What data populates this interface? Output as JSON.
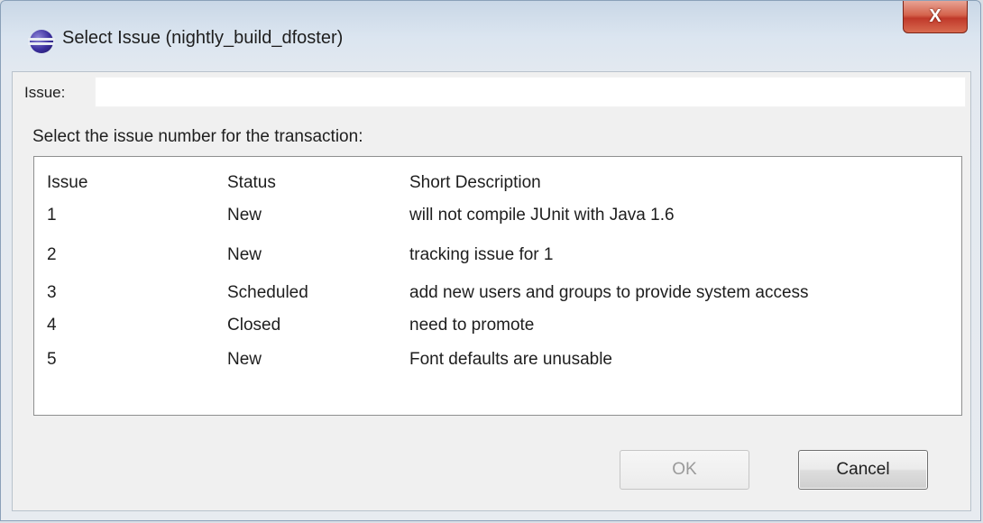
{
  "window": {
    "title": "Select Issue (nightly_build_dfoster)",
    "close_glyph": "X",
    "icon": "eclipse-icon"
  },
  "issue_field": {
    "label": "Issue:",
    "value": ""
  },
  "instruction": "Select the issue number for the transaction:",
  "table": {
    "columns": [
      "Issue",
      "Status",
      "Short Description"
    ],
    "rows": [
      {
        "issue": "1",
        "status": "New",
        "description": "will not compile JUnit with Java 1.6"
      },
      {
        "issue": "2",
        "status": "New",
        "description": "tracking issue for 1"
      },
      {
        "issue": "3",
        "status": "Scheduled",
        "description": "add new users and groups to provide system access"
      },
      {
        "issue": "4",
        "status": "Closed",
        "description": "need to promote"
      },
      {
        "issue": "5",
        "status": "New",
        "description": "Font defaults are unusable"
      }
    ]
  },
  "buttons": {
    "ok_label": "OK",
    "ok_enabled": false,
    "cancel_label": "Cancel"
  }
}
